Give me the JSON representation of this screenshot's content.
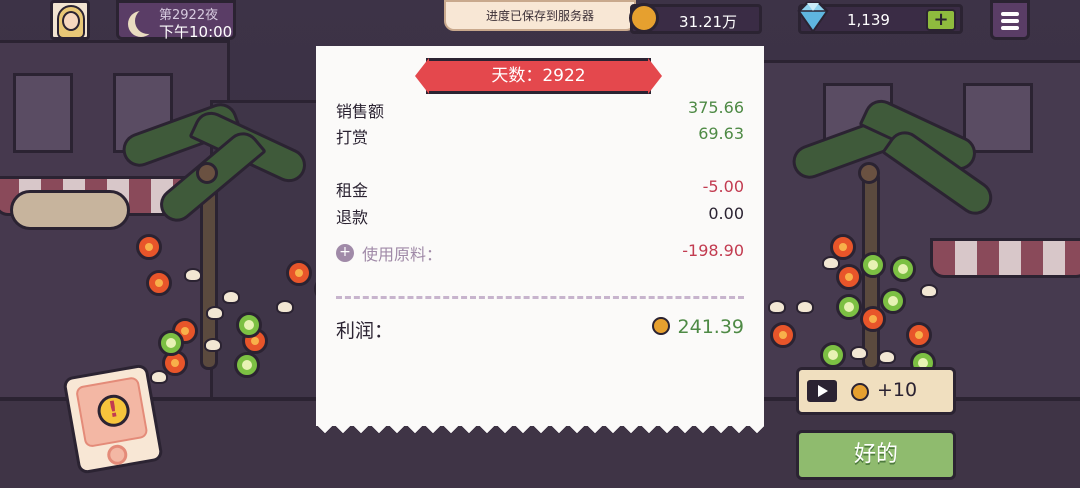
{
  "top_bar": {
    "night_label": "第2922夜",
    "time_label": "下午10:00",
    "toast": "进度已保存到服务器",
    "coins": "31.21万",
    "gems": "1,139",
    "add_symbol": "+"
  },
  "receipt": {
    "day_banner": "天数：2922",
    "rows": [
      {
        "label": "销售额",
        "amount": "375.66"
      },
      {
        "label": "打赏",
        "amount": "69.63"
      },
      {
        "label": "租金",
        "amount": "-5.00"
      },
      {
        "label": "退款",
        "amount": "0.00"
      },
      {
        "label": "使用原料：",
        "amount": "-198.90"
      }
    ],
    "plus_symbol": "+",
    "profit_label": "利润：",
    "profit_amount": "241.39"
  },
  "buttons": {
    "ad_reward": "+10",
    "ok": "好的"
  },
  "alert_symbol": "!",
  "colors": {
    "income_green": "#4e8a45",
    "expense_red": "#c23b50",
    "banner_red": "#e4484d",
    "ok_button": "#8fbb6e"
  },
  "icons": [
    "moon-icon",
    "coin-icon",
    "diamond-icon",
    "menu-icon",
    "play-video-icon",
    "alert-icon"
  ]
}
